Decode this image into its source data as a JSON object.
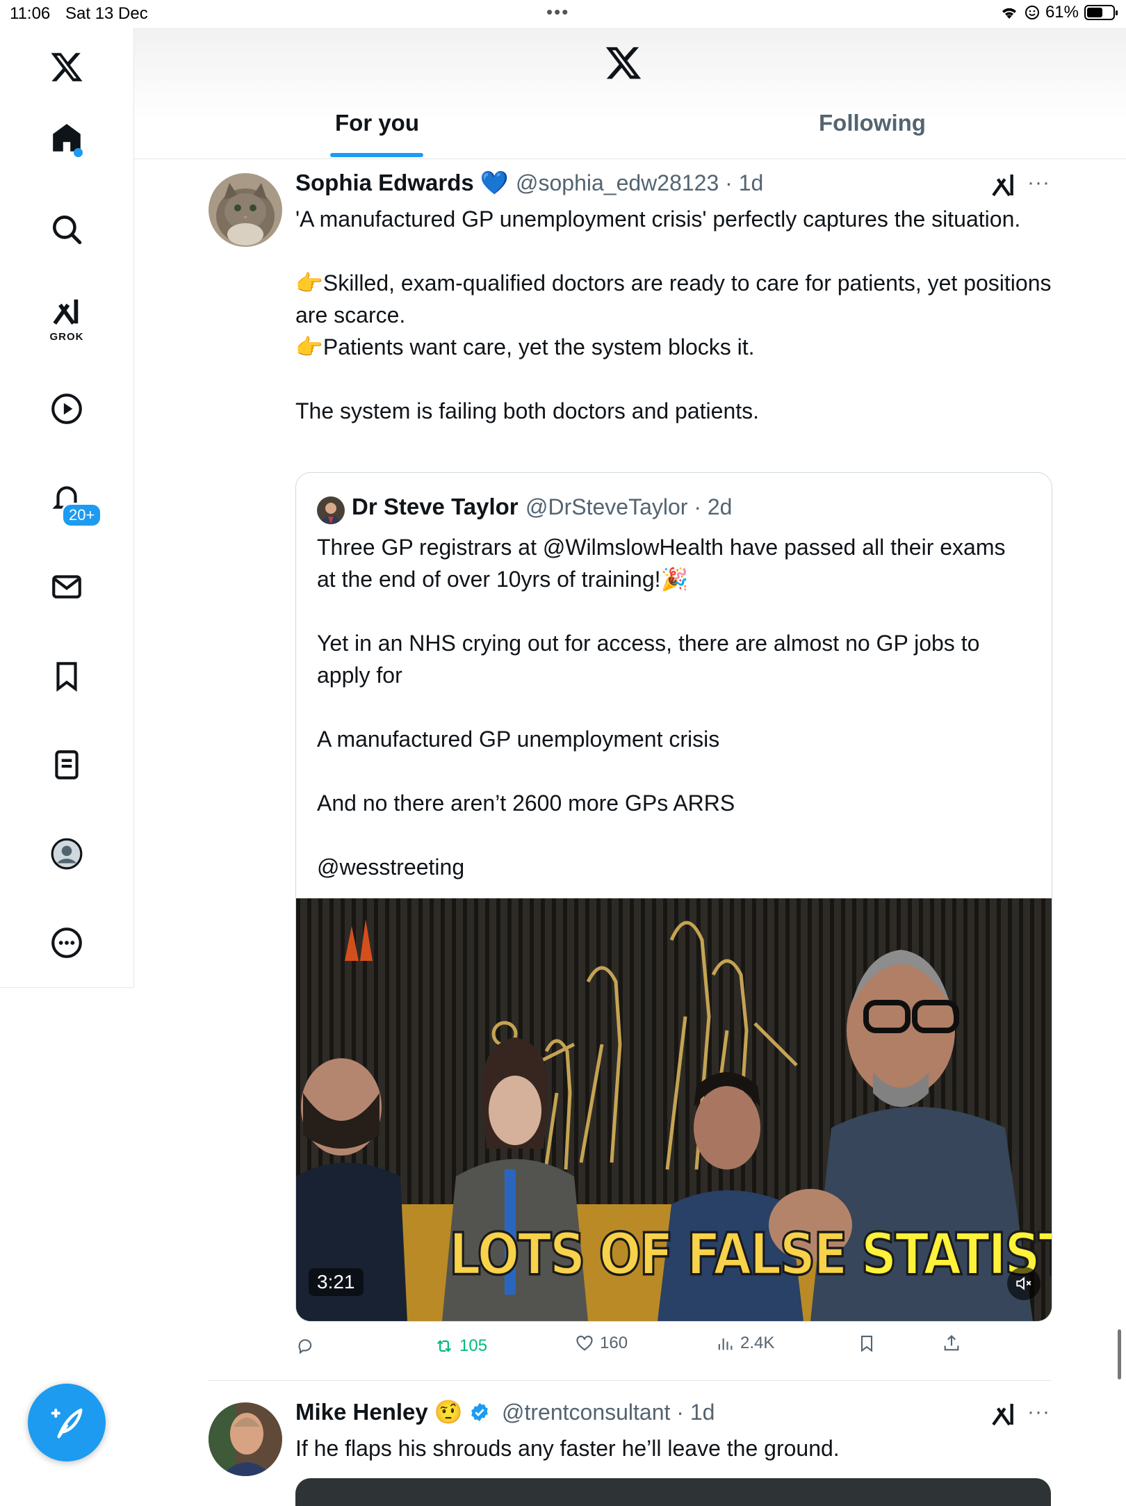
{
  "status_bar": {
    "time": "11:06",
    "date": "Sat 13 Dec",
    "battery": "61%",
    "battery_level": 0.61
  },
  "sidebar": {
    "grok_label": "GROK",
    "notifications_badge": "20+"
  },
  "tabs": [
    {
      "label": "For you",
      "active": true
    },
    {
      "label": "Following",
      "active": false
    }
  ],
  "post1": {
    "name": "Sophia Edwards",
    "badge_emoji": "💙",
    "handle_time": "@sophia_edw28123 · 1d",
    "text": "'A manufactured GP unemployment crisis' perfectly captures the situation.\n\n👉Skilled, exam-qualified doctors are ready to care for patients, yet positions are scarce.\n👉Patients want care, yet the system blocks it.\n\nThe system is failing both doctors and patients.",
    "more": "···",
    "quote": {
      "name": "Dr Steve Taylor",
      "handle_time": "@DrSteveTaylor · 2d",
      "text": "Three GP registrars at @WilmslowHealth have passed all their exams at the end of over 10yrs of training!🎉\n\nYet in an NHS crying out for access, there are almost no GP jobs to apply for\n\nA manufactured GP unemployment crisis\n\nAnd no there aren’t 2600 more GPs ARRS\n\n@wesstreeting",
      "video": {
        "duration": "3:21",
        "caption_a": "LOTS OF FALSE",
        "caption_b": "STATISTICS"
      }
    },
    "actions": {
      "replies": "",
      "reposts": "105",
      "likes": "160",
      "views": "2.4K"
    }
  },
  "post2": {
    "name": "Mike Henley",
    "emoji": "🤨",
    "handle_time": "@trentconsultant · 1d",
    "text": "If he flaps his shrouds any faster he’ll leave the ground.",
    "more": "···"
  },
  "colors": {
    "accent": "#1d9bf0",
    "repost": "#00ba7c",
    "muted": "#536471"
  }
}
